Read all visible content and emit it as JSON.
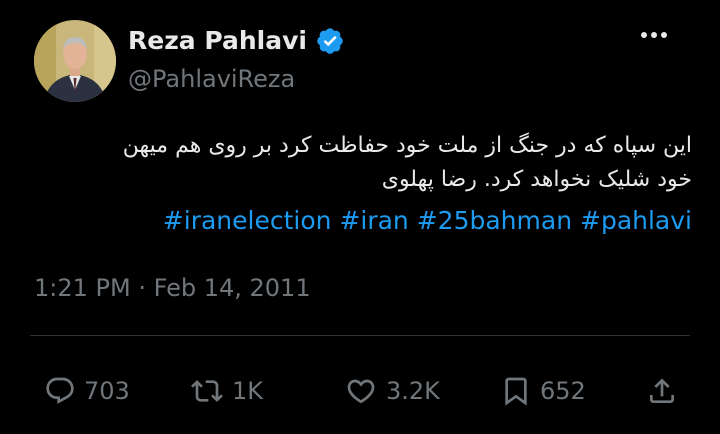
{
  "author": {
    "display_name": "Reza Pahlavi",
    "handle": "@PahlaviReza",
    "verified": true,
    "avatar_icon": "profile-photo"
  },
  "tweet": {
    "text_lines": [
      "این سپاه که در جنگ از ملت خود حفاظت کرد بر روی هم میهن",
      "خود شلیک نخواهد کرد.  رضا پهلوی"
    ],
    "hashtags": [
      "#iranelection",
      "#iran",
      "#25bahman",
      "#pahlavi"
    ],
    "timestamp": "1:21 PM · Feb 14, 2011"
  },
  "actions": {
    "replies": "703",
    "reposts": "1K",
    "likes": "3.2K",
    "bookmarks": "652"
  },
  "colors": {
    "background": "#000000",
    "text": "#e7e9ea",
    "muted": "#71767b",
    "link": "#1d9bf0",
    "verified_badge": "#1d9bf0",
    "divider": "#2f3336"
  }
}
